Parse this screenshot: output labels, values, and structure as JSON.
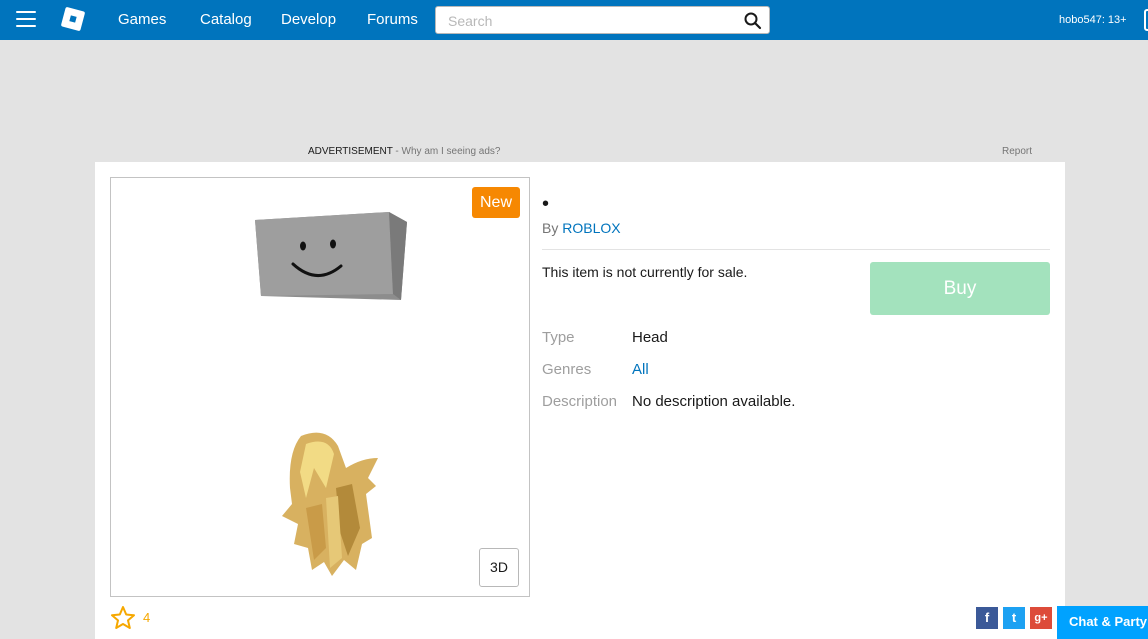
{
  "header": {
    "nav": [
      "Games",
      "Catalog",
      "Develop",
      "Forums"
    ],
    "search_placeholder": "Search",
    "user": "hobo547: 13+",
    "menu_icon": "hamburger-icon",
    "logo_icon": "roblox-logo",
    "search_icon": "magnifier-icon"
  },
  "ad": {
    "label": "ADVERTISEMENT",
    "why": " - Why am I seeing ads?",
    "report": "Report"
  },
  "item": {
    "title": "•",
    "by_prefix": "By ",
    "creator": "ROBLOX",
    "badge": "New",
    "view_3d": "3D",
    "sale_status": "This item is not currently for sale.",
    "buy_label": "Buy",
    "fields": [
      {
        "label": "Type",
        "value": "Head"
      },
      {
        "label": "Genres",
        "value": "All"
      },
      {
        "label": "Description",
        "value": "No description available."
      }
    ],
    "favorites": "4"
  },
  "share": {
    "facebook": "f",
    "twitter": "t",
    "google": "g+"
  },
  "chat": "Chat & Party",
  "colors": {
    "header": "#0074bd",
    "link": "#0074bd",
    "badge": "#f68802",
    "buy_disabled": "#a3e2bd",
    "chat": "#00a2ff",
    "star": "#f6a800"
  }
}
